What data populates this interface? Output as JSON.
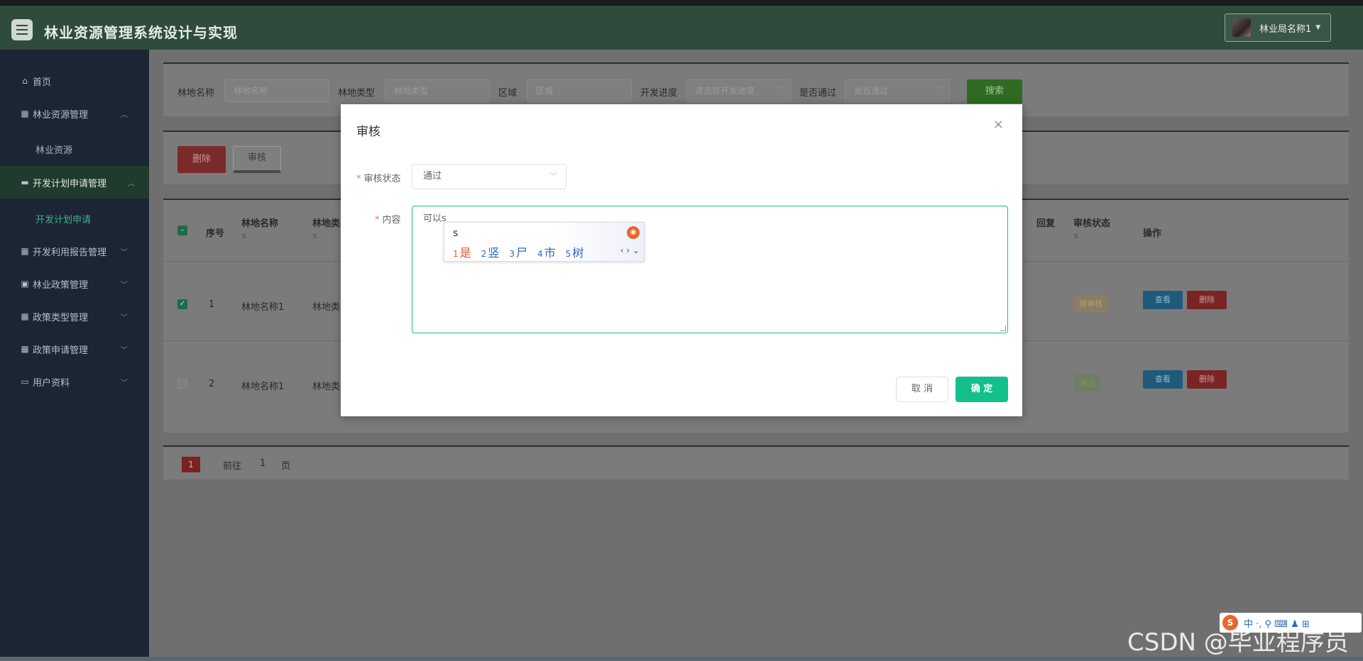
{
  "app": {
    "title": "林业资源管理系统设计与实现"
  },
  "user": {
    "name": "林业局名称1"
  },
  "sidebar": {
    "items": [
      {
        "label": "首页",
        "icon": "home-icon"
      },
      {
        "label": "林业资源管理",
        "icon": "bank-icon",
        "expanded": true
      },
      {
        "label": "林业资源",
        "sub": true
      },
      {
        "label": "开发计划申请管理",
        "icon": "comment-icon",
        "expanded": true,
        "active": true
      },
      {
        "label": "开发计划申请",
        "sub": true,
        "current": true
      },
      {
        "label": "开发利用报告管理",
        "icon": "grid-icon"
      },
      {
        "label": "林业政策管理",
        "icon": "document-icon"
      },
      {
        "label": "政策类型管理",
        "icon": "grid-icon"
      },
      {
        "label": "政策申请管理",
        "icon": "grid-icon"
      },
      {
        "label": "用户资料",
        "icon": "calendar-icon"
      }
    ]
  },
  "search": {
    "name_label": "林地名称",
    "name_placeholder": "林地名称",
    "type_label": "林地类型",
    "type_placeholder": "林地类型",
    "area_label": "区域",
    "area_placeholder": "区域",
    "progress_label": "开发进度",
    "progress_placeholder": "请选择开发进度",
    "pass_label": "是否通过",
    "pass_placeholder": "是否通过",
    "search_button": "搜索"
  },
  "actions": {
    "delete": "删除",
    "audit": "审核"
  },
  "table": {
    "headers": {
      "seq": "序号",
      "name": "林地名称",
      "type": "林地类",
      "reply": "回复",
      "status": "审核状态",
      "ops": "操作"
    },
    "rows": [
      {
        "seq": "1",
        "name": "林地名称1",
        "type": "林地类",
        "status": "待审核",
        "checked": true
      },
      {
        "seq": "2",
        "name": "林地名称1",
        "type": "林地类",
        "status": "通过",
        "checked": false
      }
    ],
    "view": "查看",
    "delete": "删除"
  },
  "pagination": {
    "current": "1",
    "goto": "前往",
    "page_value": "1",
    "page_unit": "页"
  },
  "dialog": {
    "title": "审核",
    "status_label": "审核状态",
    "status_value": "通过",
    "content_label": "内容",
    "content_value": "可以s",
    "cancel": "取 消",
    "confirm": "确 定"
  },
  "ime": {
    "input": "s",
    "candidates": [
      {
        "n": "1",
        "c": "是"
      },
      {
        "n": "2",
        "c": "竖"
      },
      {
        "n": "3",
        "c": "尸"
      },
      {
        "n": "4",
        "c": "市"
      },
      {
        "n": "5",
        "c": "树"
      }
    ],
    "toolbar": "中 ·, ⚲ ⌨ ♟ ⊞"
  },
  "watermark": "CSDN @毕业程序员",
  "colors": {
    "header": "#2f4b3c",
    "sidebar": "#1c2533",
    "accent": "#13c08c",
    "danger": "#f56c6c"
  }
}
